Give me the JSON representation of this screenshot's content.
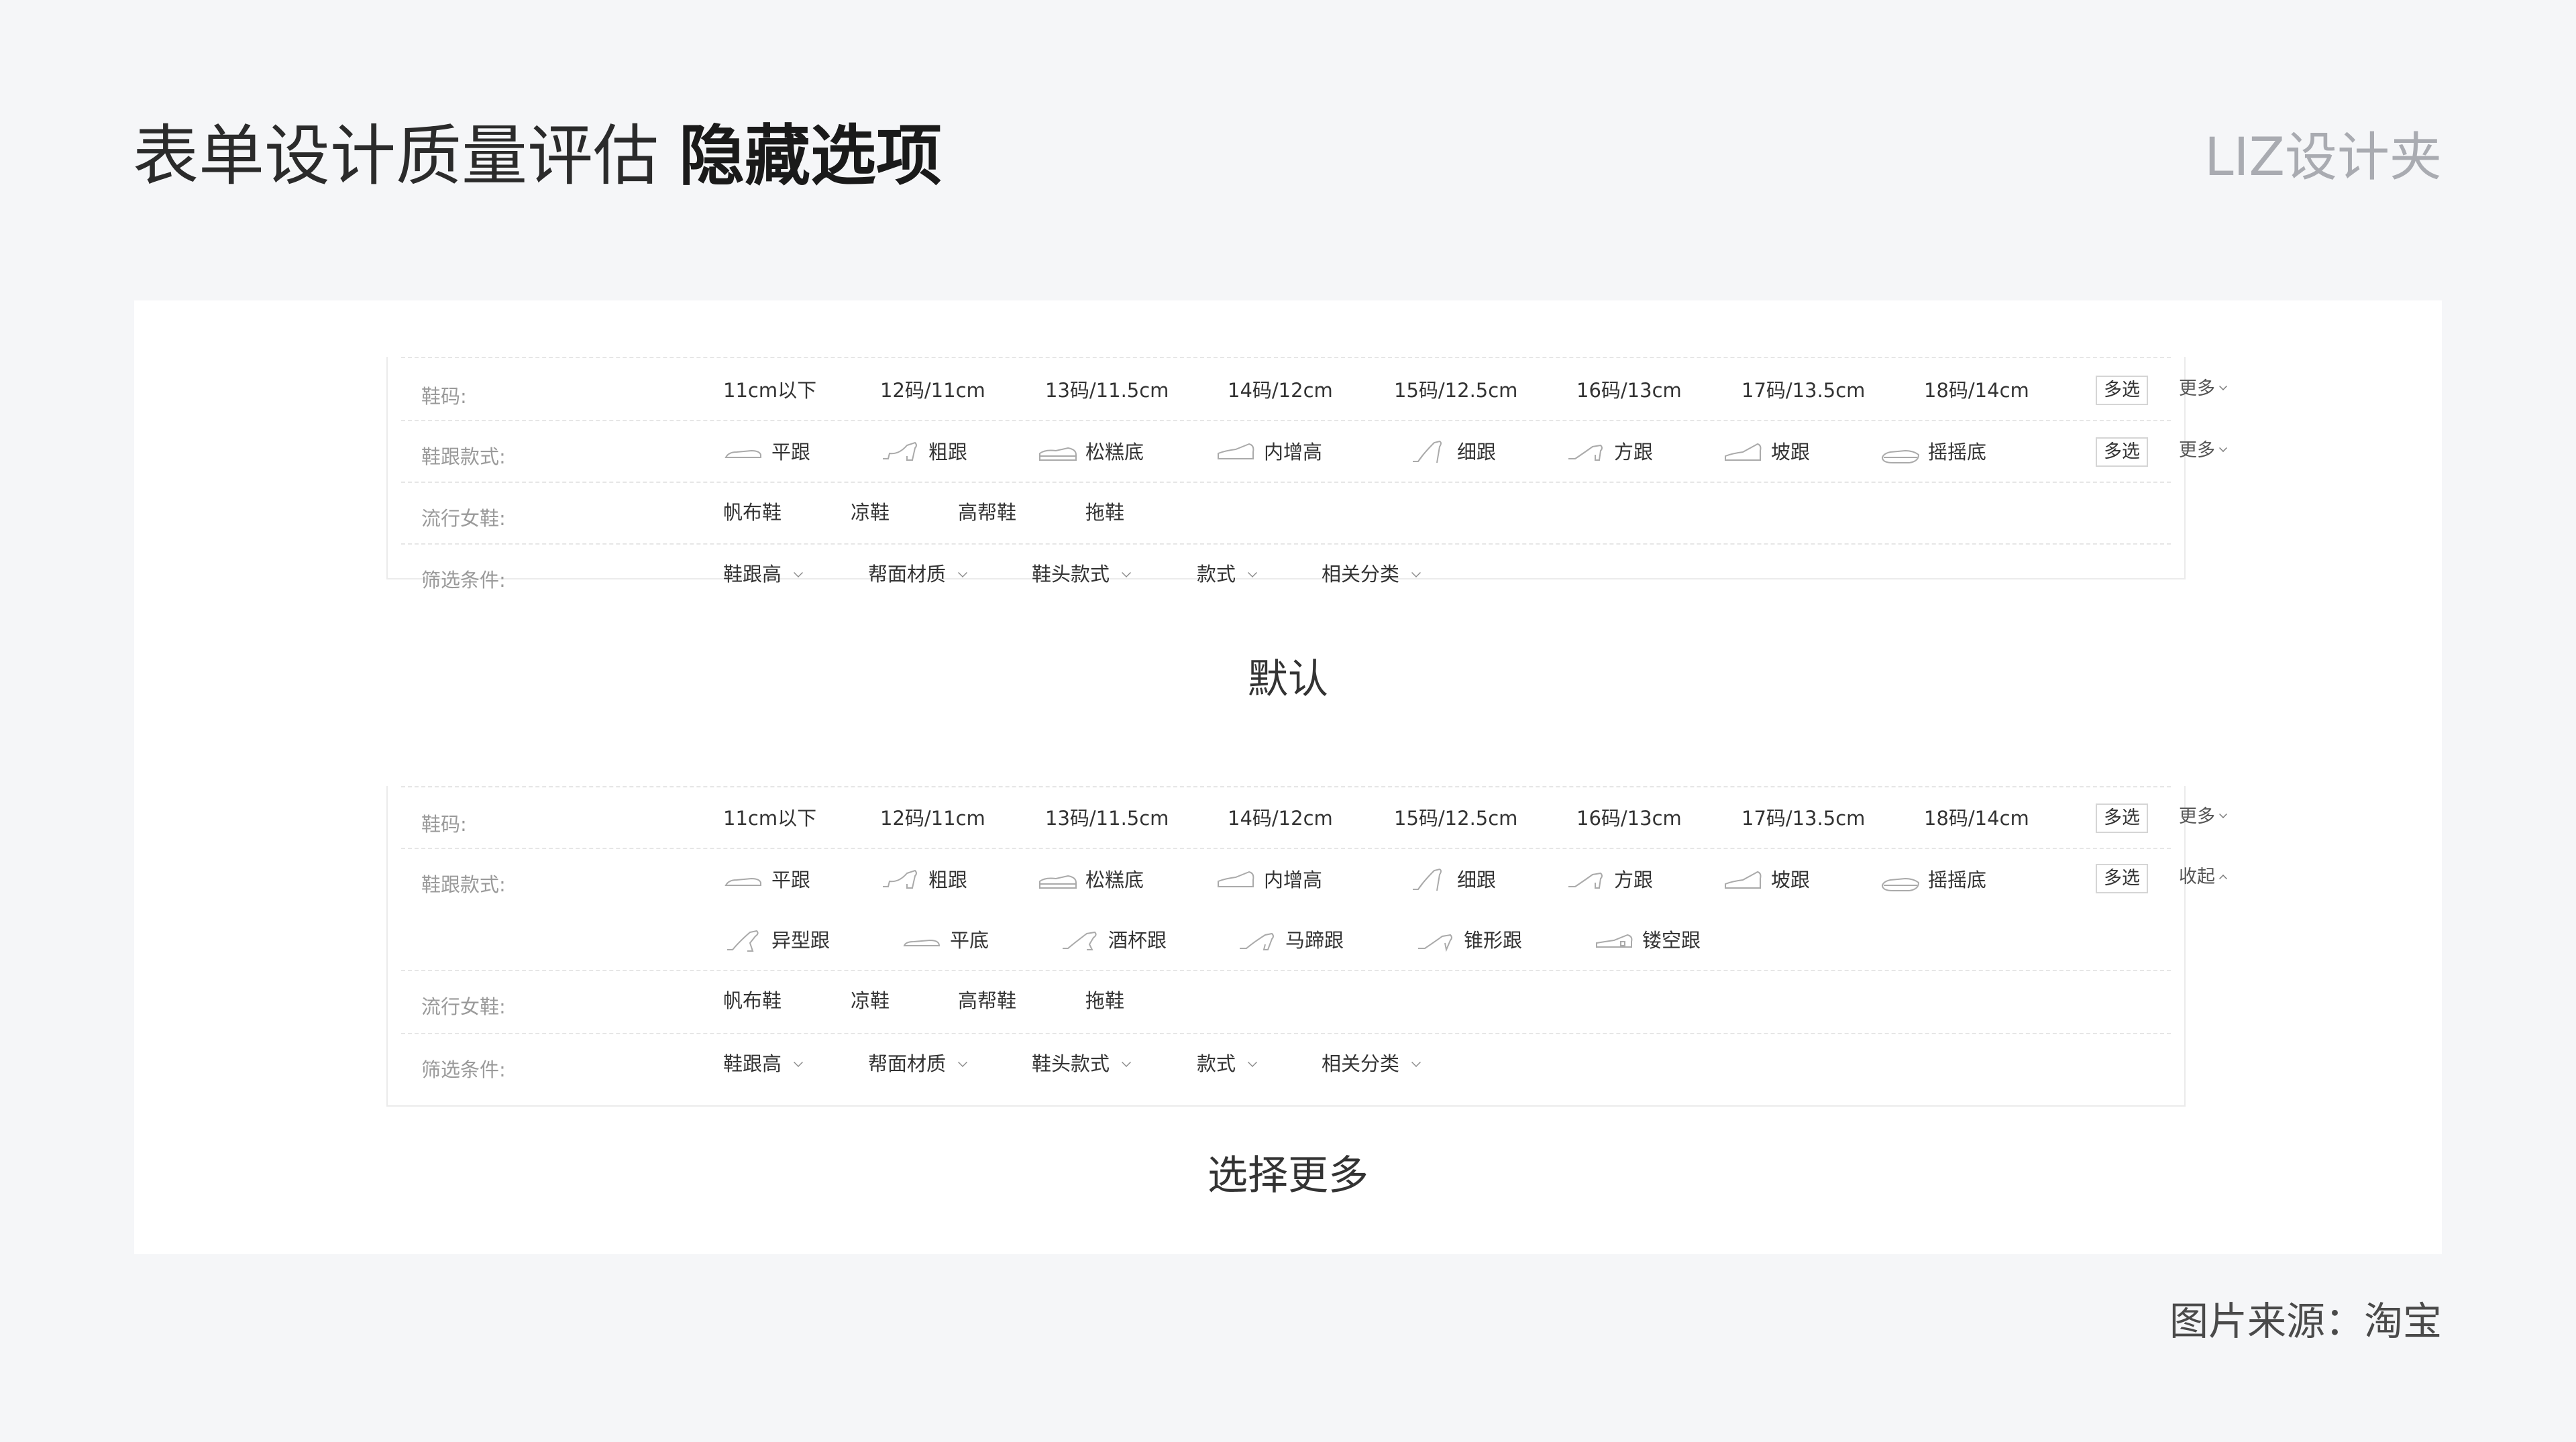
{
  "title": {
    "main": "表单设计质量评估",
    "highlight": "隐藏选项"
  },
  "brand": "LIZ设计夹",
  "source": "图片来源：淘宝",
  "panel_default": {
    "caption": "默认",
    "size": {
      "label": "鞋码:",
      "options": [
        "11cm以下",
        "12码/11cm",
        "13码/11.5cm",
        "14码/12cm",
        "15码/12.5cm",
        "16码/13cm",
        "17码/13.5cm",
        "18码/14cm"
      ],
      "multi": "多选",
      "more": "更多"
    },
    "heel": {
      "label": "鞋跟款式:",
      "options": [
        "平跟",
        "粗跟",
        "松糕底",
        "内增高",
        "细跟",
        "方跟",
        "坡跟",
        "摇摇底"
      ],
      "multi": "多选",
      "more": "更多"
    },
    "popular": {
      "label": "流行女鞋:",
      "options": [
        "帆布鞋",
        "凉鞋",
        "高帮鞋",
        "拖鞋"
      ]
    },
    "filter": {
      "label": "筛选条件:",
      "options": [
        "鞋跟高",
        "帮面材质",
        "鞋头款式",
        "款式",
        "相关分类"
      ]
    }
  },
  "panel_expanded": {
    "caption": "选择更多",
    "size": {
      "label": "鞋码:",
      "options": [
        "11cm以下",
        "12码/11cm",
        "13码/11.5cm",
        "14码/12cm",
        "15码/12.5cm",
        "16码/13cm",
        "17码/13.5cm",
        "18码/14cm"
      ],
      "multi": "多选",
      "more": "更多"
    },
    "heel": {
      "label": "鞋跟款式:",
      "options": [
        "平跟",
        "粗跟",
        "松糕底",
        "内增高",
        "细跟",
        "方跟",
        "坡跟",
        "摇摇底"
      ],
      "extra_options": [
        "异型跟",
        "平底",
        "酒杯跟",
        "马蹄跟",
        "锥形跟",
        "镂空跟"
      ],
      "multi": "多选",
      "collapse": "收起"
    },
    "popular": {
      "label": "流行女鞋:",
      "options": [
        "帆布鞋",
        "凉鞋",
        "高帮鞋",
        "拖鞋"
      ]
    },
    "filter": {
      "label": "筛选条件:",
      "options": [
        "鞋跟高",
        "帮面材质",
        "鞋头款式",
        "款式",
        "相关分类"
      ]
    }
  }
}
